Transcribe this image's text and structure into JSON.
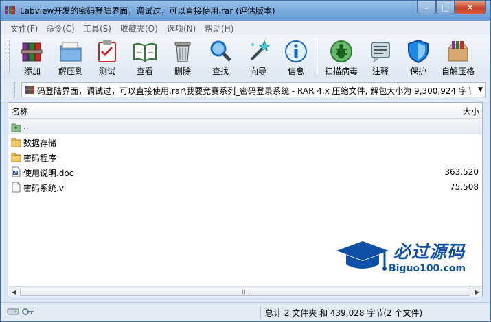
{
  "window": {
    "title": "Labview开发的密码登陆界面，调试过，可以直接使用.rar (评估版本)",
    "min_glyph": "–",
    "max_glyph": "□",
    "close_glyph": "✕"
  },
  "menu": [
    {
      "label": "文件(F)"
    },
    {
      "label": "命令(C)"
    },
    {
      "label": "工具(S)"
    },
    {
      "label": "收藏夹(O)"
    },
    {
      "label": "选项(N)"
    },
    {
      "label": "帮助(H)"
    }
  ],
  "toolbar": [
    {
      "label": "添加",
      "icon": "books-icon"
    },
    {
      "label": "解压到",
      "icon": "folder-extract-icon"
    },
    {
      "label": "测试",
      "icon": "clipboard-check-icon"
    },
    {
      "label": "查看",
      "icon": "open-book-icon"
    },
    {
      "label": "删除",
      "icon": "trash-icon"
    },
    {
      "label": "查找",
      "icon": "magnifier-icon"
    },
    {
      "label": "向导",
      "icon": "magic-wand-icon"
    },
    {
      "label": "信息",
      "icon": "info-icon"
    },
    {
      "label": "扫描病毒",
      "icon": "bug-icon"
    },
    {
      "label": "注释",
      "icon": "note-icon"
    },
    {
      "label": "保护",
      "icon": "shield-icon"
    },
    {
      "label": "自解压格",
      "icon": "box-icon"
    }
  ],
  "address": {
    "text": "码登陆界面，调试过，可以直接使用.rar\\我要竞赛系列_密码登录系统 - RAR 4.x 压缩文件, 解包大小为 9,300,924 字节",
    "dropdown_glyph": "▼"
  },
  "list": {
    "columns": {
      "name": "名称",
      "size": "大小"
    },
    "rows": [
      {
        "name": "..",
        "size": "",
        "icon": "parent-folder-icon"
      },
      {
        "name": "数据存储",
        "size": "",
        "icon": "folder-icon"
      },
      {
        "name": "密码程序",
        "size": "",
        "icon": "folder-icon"
      },
      {
        "name": "使用说明.doc",
        "size": "363,520",
        "icon": "word-doc-icon"
      },
      {
        "name": "密码系统.vi",
        "size": "75,508",
        "icon": "file-icon"
      }
    ]
  },
  "scroll": {
    "left": "◀",
    "right": "▶"
  },
  "watermark": {
    "title": "必过源码",
    "subtitle": "Biguo100.com"
  },
  "status": {
    "text": "总计 2 文件夹 和 439,028 字节(2 个文件)"
  },
  "colors": {
    "accent": "#0e4fa7",
    "title_bar": "#79a9dd",
    "close": "#c7432a"
  }
}
